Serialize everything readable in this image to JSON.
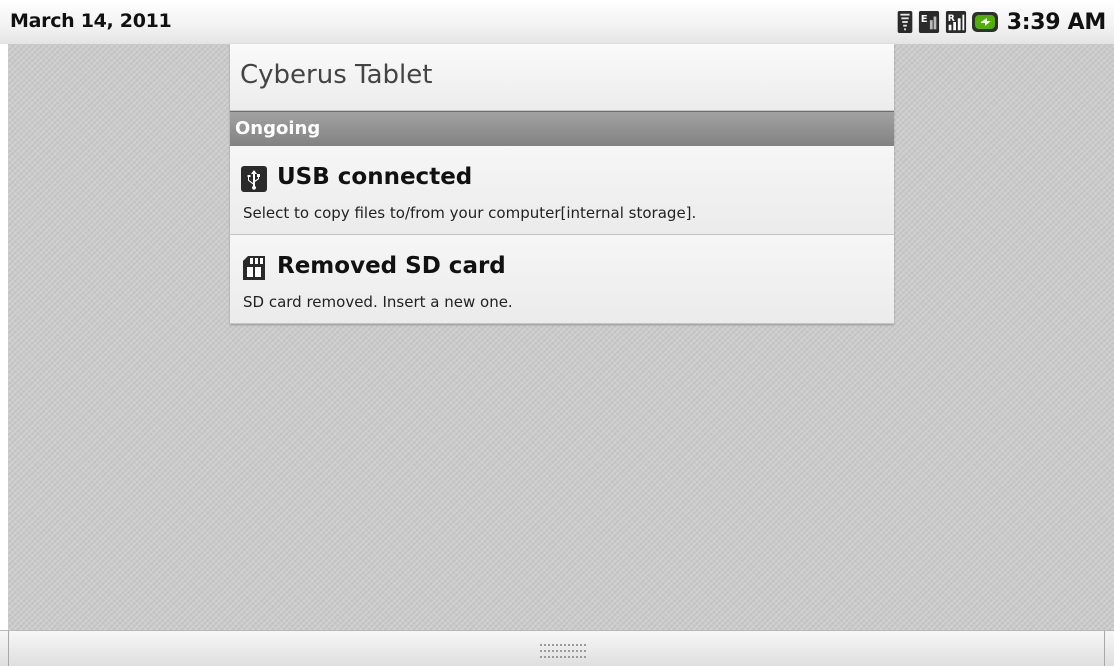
{
  "status_bar": {
    "date": "March 14, 2011",
    "time": "3:39 AM",
    "icons": [
      "wifi-icon",
      "data-e-icon",
      "signal-r-icon",
      "battery-charging-icon"
    ]
  },
  "panel": {
    "title": "Cyberus Tablet",
    "section": "Ongoing",
    "notifications": [
      {
        "icon": "usb-icon",
        "title": "USB connected",
        "text": "Select to copy files to/from your computer[internal storage]."
      },
      {
        "icon": "sd-card-icon",
        "title": "Removed SD card",
        "text": "SD card removed. Insert a new one."
      }
    ]
  },
  "bottom_bar": {
    "handle_icon": "drag-handle-icon"
  },
  "colors": {
    "section_header": "#8c8c8c",
    "battery_accent": "#4fb000",
    "background": "#cccccc"
  }
}
